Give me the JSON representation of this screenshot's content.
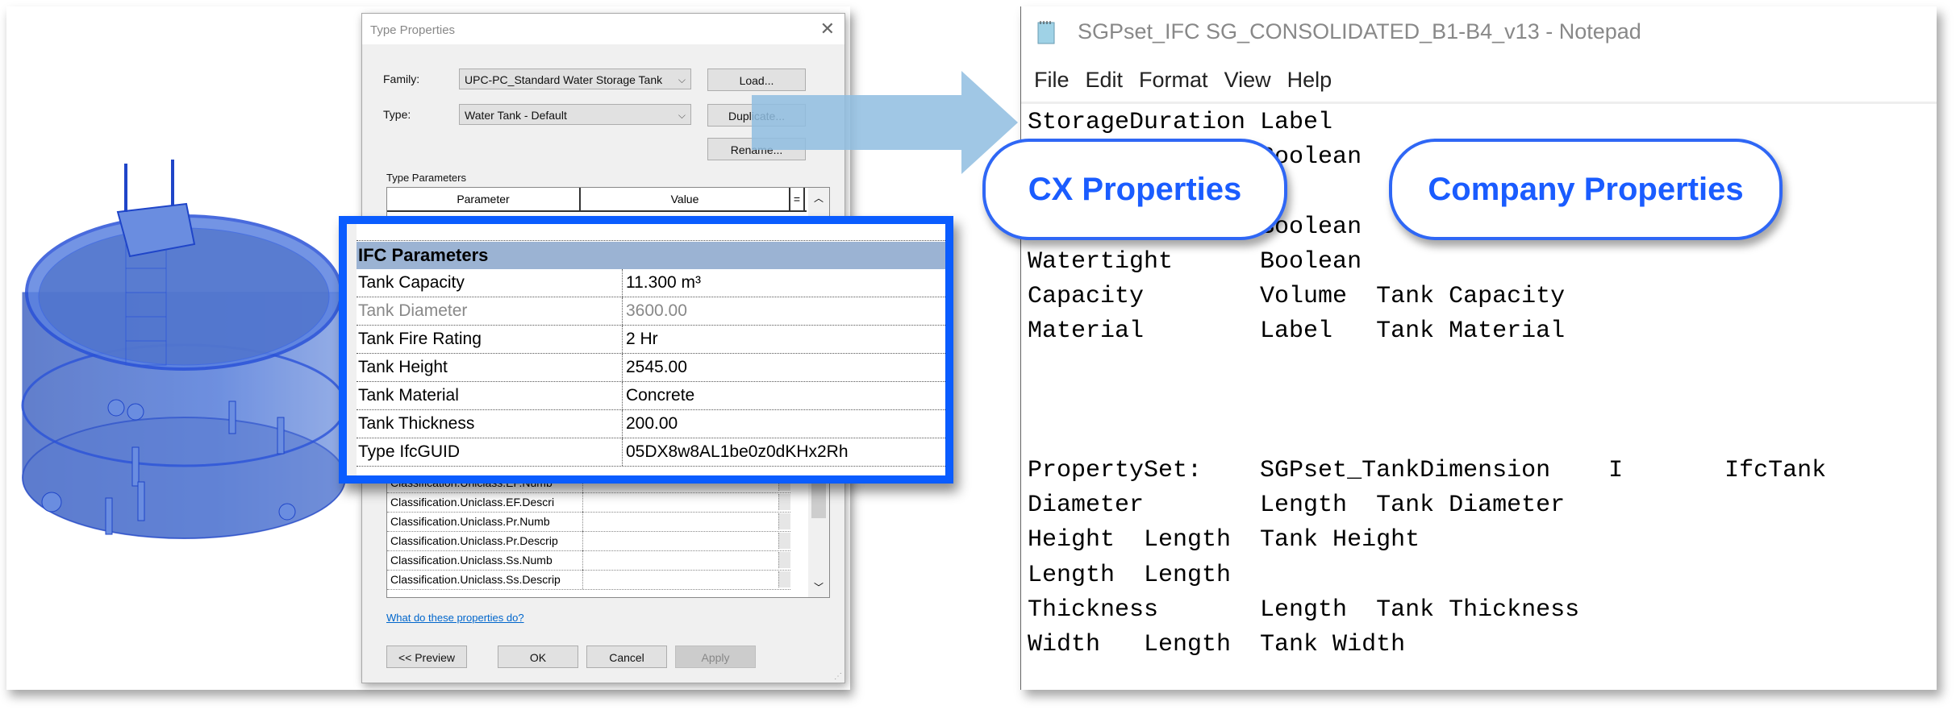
{
  "type_properties_dialog": {
    "title": "Type Properties",
    "family_label": "Family:",
    "family_value": "UPC-PC_Standard Water Storage Tank",
    "type_label": "Type:",
    "type_value": "Water Tank - Default",
    "buttons": {
      "load": "Load...",
      "duplicate": "Duplicate...",
      "rename": "Rename...",
      "preview": "<< Preview",
      "ok": "OK",
      "cancel": "Cancel",
      "apply": "Apply"
    },
    "type_parameters_label": "Type Parameters",
    "columns": [
      "Parameter",
      "Value",
      "="
    ],
    "classification_rows": [
      "Classification.Uniclass.EF.Numb",
      "Classification.Uniclass.EF.Descri",
      "Classification.Uniclass.Pr.Numb",
      "Classification.Uniclass.Pr.Descrip",
      "Classification.Uniclass.Ss.Numb",
      "Classification.Uniclass.Ss.Descrip"
    ],
    "help_link": "What do these properties do?"
  },
  "ifc_parameters": {
    "heading": "IFC Parameters",
    "rows": [
      {
        "name": "Tank Capacity",
        "value": "11.300 m³",
        "disabled": false
      },
      {
        "name": "Tank Diameter",
        "value": "3600.00",
        "disabled": true
      },
      {
        "name": "Tank Fire Rating",
        "value": "2 Hr",
        "disabled": false
      },
      {
        "name": "Tank Height",
        "value": "2545.00",
        "disabled": false
      },
      {
        "name": "Tank Material",
        "value": "Concrete",
        "disabled": false
      },
      {
        "name": "Tank Thickness",
        "value": "200.00",
        "disabled": false
      },
      {
        "name": "Type IfcGUID",
        "value": "05DX8w8AL1be0z0dKHx2Rh",
        "disabled": false
      }
    ]
  },
  "notepad": {
    "title": "SGPset_IFC SG_CONSOLIDATED_B1-B4_v13 - Notepad",
    "menu": [
      "File",
      "Edit",
      "Format",
      "View",
      "Help"
    ],
    "lines": [
      "StorageDuration Label",
      "                Boolean",
      "",
      "                Boolean",
      "Watertight      Boolean",
      "Capacity        Volume  Tank Capacity",
      "Material        Label   Tank Material",
      "",
      "",
      "",
      "PropertySet:    SGPset_TankDimension    I       IfcTank",
      "Diameter        Length  Tank Diameter",
      "Height  Length  Tank Height",
      "Length  Length",
      "Thickness       Length  Tank Thickness",
      "Width   Length  Tank Width"
    ]
  },
  "callouts": {
    "cx": "CX Properties",
    "company": "Company Properties"
  },
  "colors": {
    "highlight_blue": "#0a5cff",
    "callout_blue": "#1a5cff",
    "arrow_blue": "#8fbde0",
    "ifc_header": "#9bb3d3"
  }
}
